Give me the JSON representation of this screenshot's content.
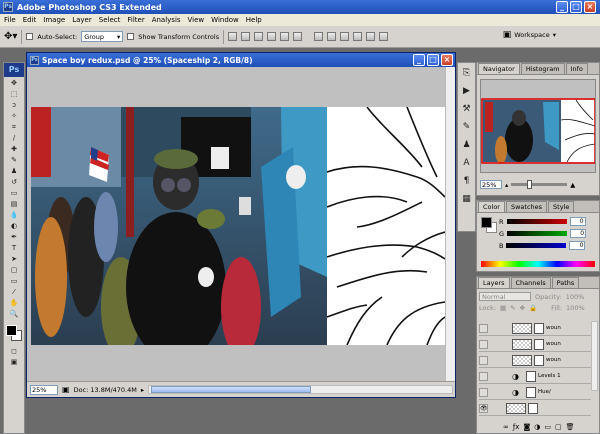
{
  "app": {
    "title": "Adobe Photoshop CS3 Extended",
    "logo": "Ps"
  },
  "window_buttons": [
    "_",
    "□",
    "×"
  ],
  "menu": [
    "File",
    "Edit",
    "Image",
    "Layer",
    "Select",
    "Filter",
    "Analysis",
    "View",
    "Window",
    "Help"
  ],
  "options_bar": {
    "auto_select_label": "Auto-Select:",
    "auto_select_value": "Group",
    "transform_label": "Show Transform Controls",
    "workspace_label": "Workspace"
  },
  "tools": [
    "move-tool",
    "marquee-tool",
    "lasso-tool",
    "magic-wand-tool",
    "crop-tool",
    "slice-tool",
    "healing-brush-tool",
    "brush-tool",
    "clone-stamp-tool",
    "history-brush-tool",
    "eraser-tool",
    "gradient-tool",
    "blur-tool",
    "dodge-tool",
    "pen-tool",
    "type-tool",
    "path-selection-tool",
    "shape-tool",
    "notes-tool",
    "eyedropper-tool",
    "hand-tool",
    "zoom-tool"
  ],
  "document": {
    "title": "Space boy redux.psd @ 25% (Spaceship 2, RGB/8)",
    "zoom": "25%",
    "doc_info": "Doc: 13.8M/470.4M"
  },
  "panels": {
    "navigator": {
      "tabs": [
        "Navigator",
        "Histogram",
        "Info"
      ],
      "zoom": "25%"
    },
    "color": {
      "tabs": [
        "Color",
        "Swatches",
        "Style"
      ],
      "r_label": "R",
      "g_label": "G",
      "b_label": "B",
      "r": "0",
      "g": "0",
      "b": "0",
      "r_color": "#cc0000",
      "g_color": "#00aa00",
      "b_color": "#0000cc"
    },
    "layers": {
      "tabs": [
        "Layers",
        "Channels",
        "Paths"
      ],
      "blend_mode": "Normal",
      "opacity_label": "Opacity:",
      "opacity": "100%",
      "lock_label": "Lock:",
      "fill_label": "Fill:",
      "fill": "100%",
      "items": [
        {
          "name": "woun"
        },
        {
          "name": "woun"
        },
        {
          "name": "woun"
        },
        {
          "name": "Levels 1"
        },
        {
          "name": "Hue/"
        },
        {
          "name": ""
        },
        {
          "name": ""
        }
      ]
    }
  }
}
